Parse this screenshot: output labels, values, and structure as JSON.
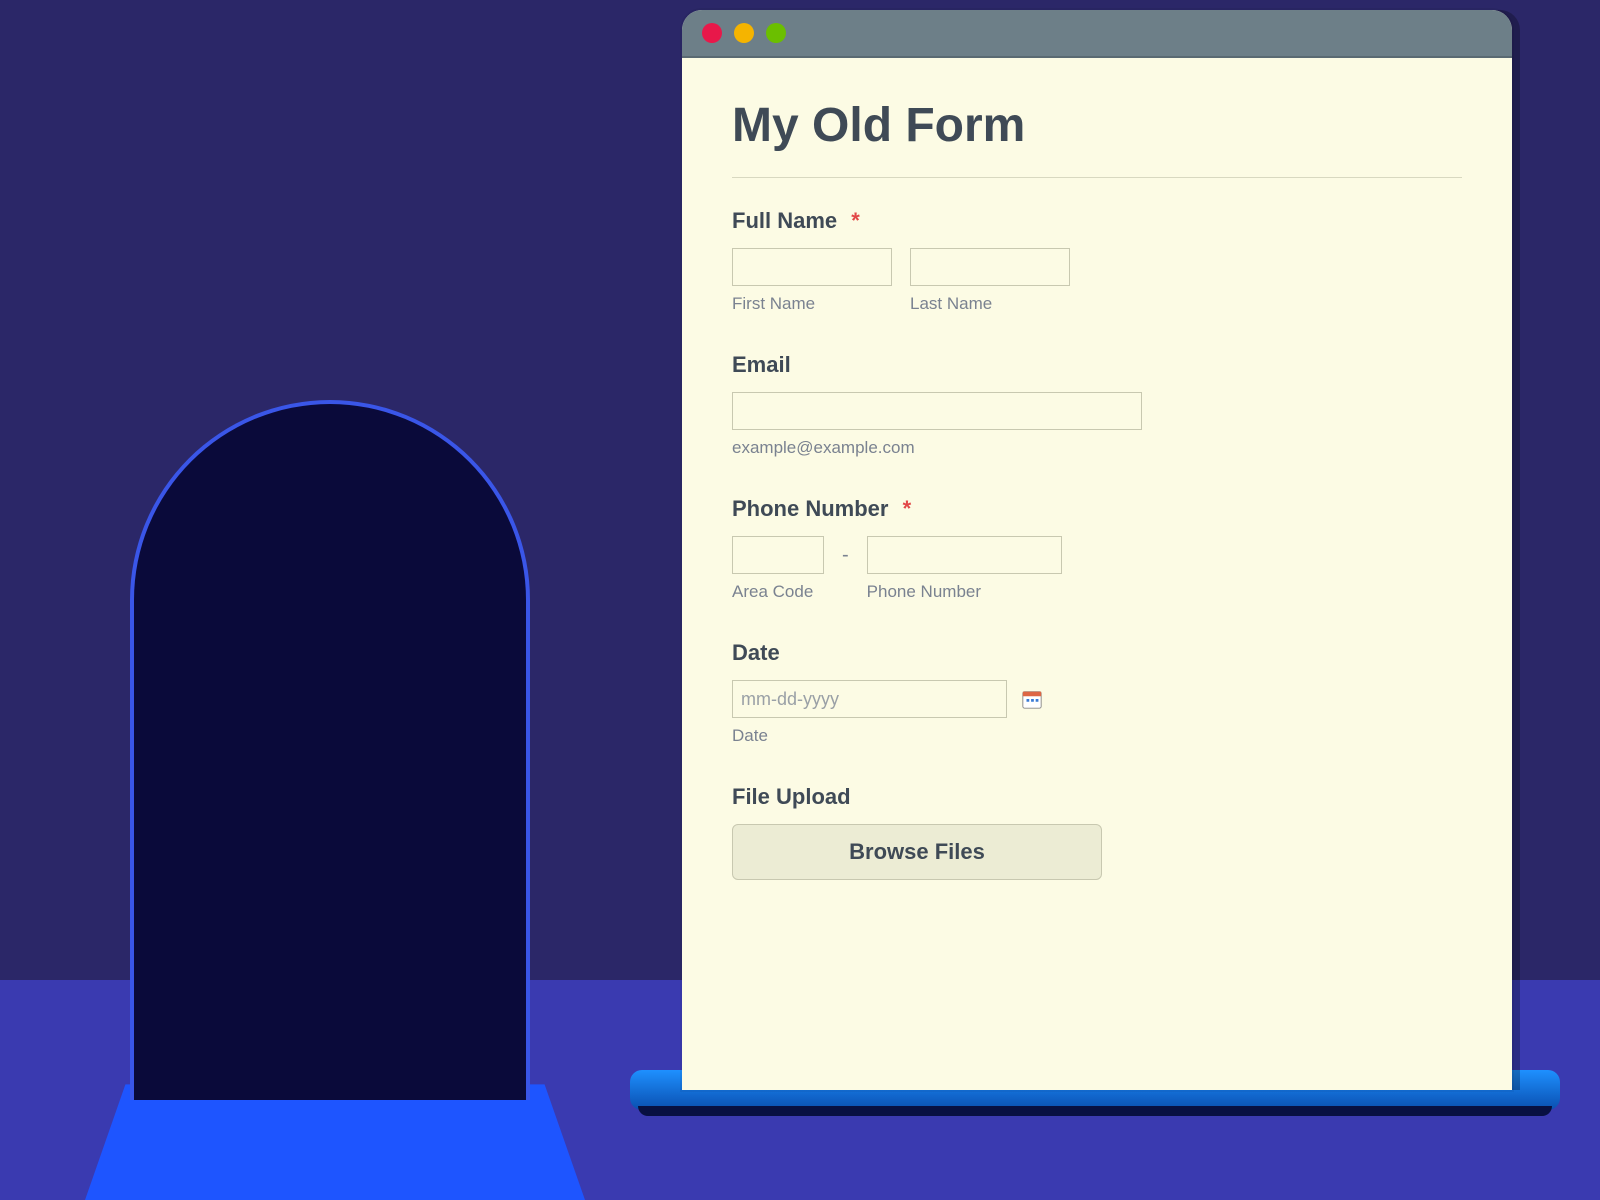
{
  "form": {
    "title": "My Old Form",
    "fields": {
      "fullName": {
        "label": "Full Name",
        "required": true,
        "first": {
          "sublabel": "First Name"
        },
        "last": {
          "sublabel": "Last Name"
        }
      },
      "email": {
        "label": "Email",
        "required": false,
        "hint": "example@example.com"
      },
      "phone": {
        "label": "Phone Number",
        "required": true,
        "area": {
          "sublabel": "Area Code"
        },
        "number": {
          "sublabel": "Phone Number"
        },
        "dash": "-"
      },
      "date": {
        "label": "Date",
        "required": false,
        "placeholder": "mm-dd-yyyy",
        "sublabel": "Date"
      },
      "fileUpload": {
        "label": "File Upload",
        "button": "Browse Files"
      }
    },
    "required_marker": "*"
  }
}
